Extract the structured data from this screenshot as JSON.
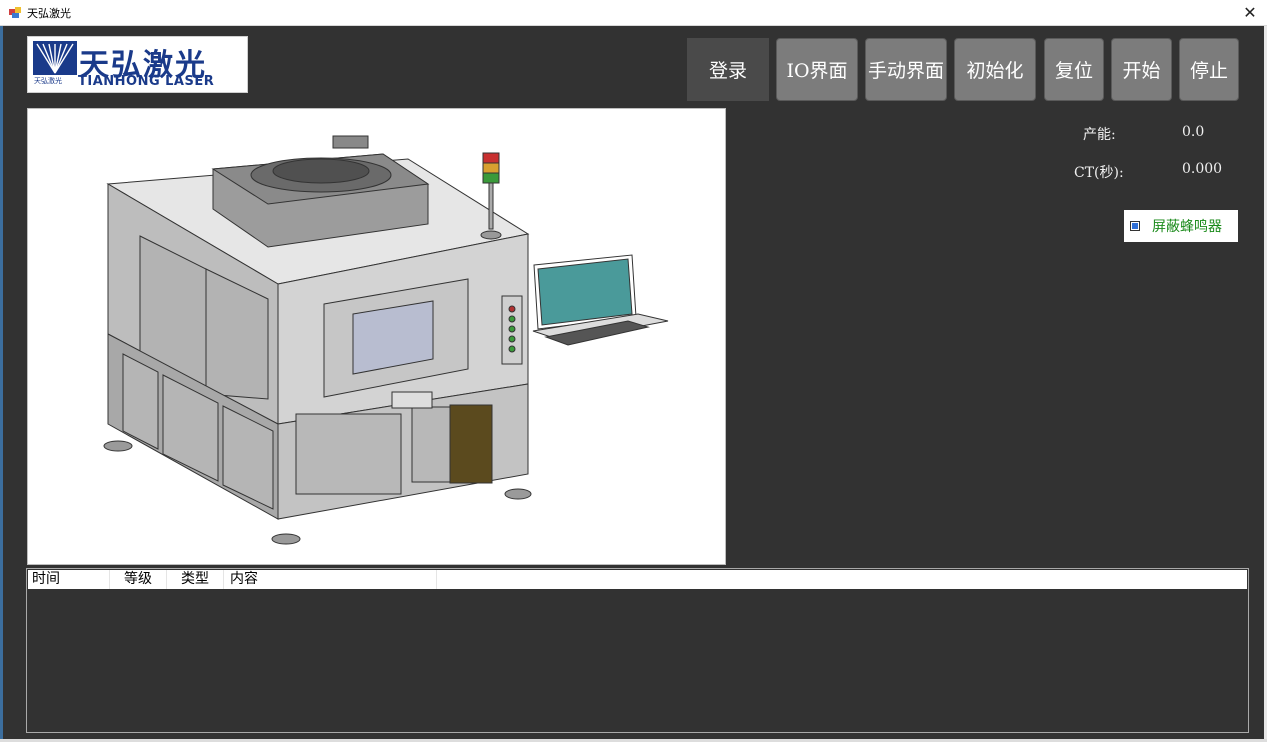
{
  "window": {
    "title": "天弘激光",
    "close_glyph": "✕"
  },
  "logo": {
    "zh": "天弘激光",
    "zh_small": "天弘激光",
    "en": "TIANHONG LASER",
    "brand_color": "#1a3a8a"
  },
  "toolbar": {
    "login": "登录",
    "io": "IO界面",
    "manual": "手动界面",
    "init": "初始化",
    "reset": "复位",
    "start": "开始",
    "stop": "停止"
  },
  "stats": {
    "capacity_label": "产能:",
    "capacity_value": "0.0",
    "ct_label": "CT(秒):",
    "ct_value": "0.000"
  },
  "mute_buzzer": {
    "label": "屏蔽蜂鸣器",
    "checked": true
  },
  "log": {
    "columns": [
      "时间",
      "等级",
      "类型",
      "内容"
    ],
    "rows": []
  },
  "colors": {
    "background": "#323232",
    "button": "#7c7c7c",
    "checkbox_text": "#1a8a1a"
  }
}
